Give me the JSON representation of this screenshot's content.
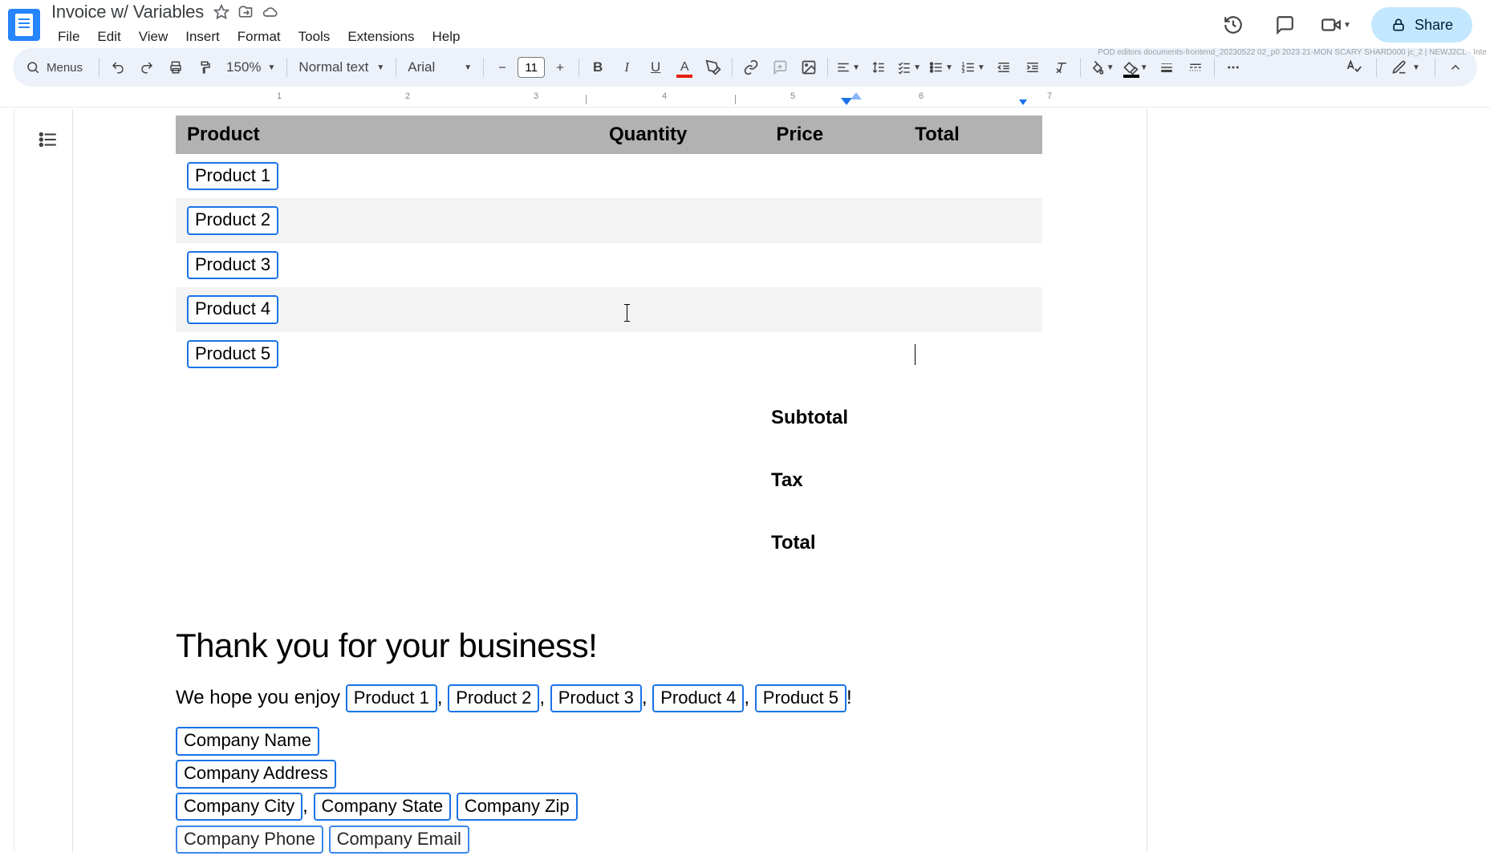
{
  "doc_title": "Invoice w/ Variables",
  "menus": [
    "File",
    "Edit",
    "View",
    "Insert",
    "Format",
    "Tools",
    "Extensions",
    "Help"
  ],
  "footer_status": "POD editors documents-frontend_20230522 02_p0 2023 21-MON SCARY SHARD000 jc_2 | NEWJ2CL · Inte",
  "toolbar": {
    "menus_label": "Menus",
    "zoom": "150%",
    "style": "Normal text",
    "font": "Arial",
    "font_size": "11"
  },
  "share_label": "Share",
  "ruler_numbers": [
    "1",
    "2",
    "3",
    "4",
    "5",
    "6",
    "7"
  ],
  "table": {
    "headers": {
      "product": "Product",
      "quantity": "Quantity",
      "price": "Price",
      "total": "Total"
    },
    "rows": [
      {
        "product": "Product 1",
        "alt": false
      },
      {
        "product": "Product 2",
        "alt": true
      },
      {
        "product": "Product 3",
        "alt": false
      },
      {
        "product": "Product 4",
        "alt": true
      },
      {
        "product": "Product 5",
        "alt": false
      }
    ]
  },
  "totals": {
    "subtotal": "Subtotal",
    "tax": "Tax",
    "total": "Total"
  },
  "thanks": "Thank you for your business!",
  "hope_prefix": "We hope you enjoy ",
  "hope_chips": [
    "Product 1",
    "Product 2",
    "Product 3",
    "Product 4",
    "Product 5"
  ],
  "company_chips": {
    "name": "Company Name",
    "address": "Company Address",
    "city": "Company City",
    "state": "Company State",
    "zip": "Company Zip",
    "phone": "Company Phone",
    "email": "Company Email"
  },
  "icons": {
    "star": "star-icon",
    "move": "move-icon",
    "cloud": "cloud-icon",
    "history": "history-icon",
    "comments": "comments-icon",
    "meet": "meet-icon",
    "search": "search-icon",
    "undo": "undo-icon",
    "redo": "redo-icon",
    "print": "print-icon",
    "paint": "paint-format-icon",
    "minus": "minus-icon",
    "plus": "plus-icon",
    "bold": "bold-icon",
    "italic": "italic-icon",
    "underline": "underline-icon",
    "textcolor": "text-color-icon",
    "highlight": "highlight-icon",
    "link": "link-icon",
    "addcomment": "add-comment-icon",
    "image": "image-icon",
    "align": "align-icon",
    "linespacing": "line-spacing-icon",
    "checklist": "checklist-icon",
    "bullets": "bulleted-list-icon",
    "numbers": "numbered-list-icon",
    "outdent": "decrease-indent-icon",
    "indent": "increase-indent-icon",
    "clear": "clear-formatting-icon",
    "fill": "fill-color-icon",
    "border": "border-color-icon",
    "borderwidth": "border-width-icon",
    "borderdash": "border-dash-icon",
    "more": "more-icon",
    "spellcheck": "spellcheck-icon",
    "editing": "editing-mode-icon",
    "collapse": "collapse-icon",
    "outline": "outline-icon",
    "lock": "lock-icon"
  }
}
